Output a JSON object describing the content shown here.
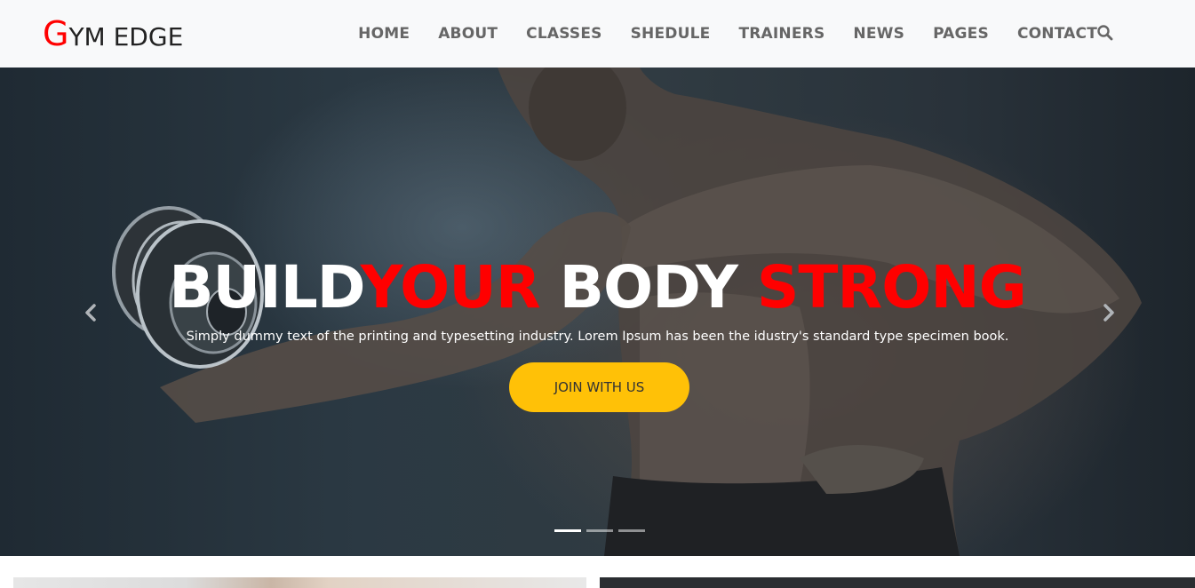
{
  "brand": {
    "logo_first": "G",
    "logo_rest": "YM EDGE",
    "accent_color": "#ff0000"
  },
  "nav": {
    "items": [
      {
        "label": "HOME"
      },
      {
        "label": "ABOUT"
      },
      {
        "label": "CLASSES"
      },
      {
        "label": "SHEDULE"
      },
      {
        "label": "TRAINERS"
      },
      {
        "label": "NEWS"
      },
      {
        "label": "PAGES"
      },
      {
        "label": "CONTACT"
      }
    ],
    "search_icon": "search-icon"
  },
  "hero": {
    "title_part1": "BUILD",
    "title_part2": "YOUR",
    "title_part3": " BODY ",
    "title_part4": "STRONG",
    "subtitle": "Simply dummy text of the printing and typesetting industry. Lorem Ipsum has been the idustry's standard type specimen book.",
    "cta_label": "JOIN WITH US",
    "cta_color": "#ffc107",
    "prev_icon": "chevron-left-icon",
    "next_icon": "chevron-right-icon",
    "slides_total": 3,
    "active_slide": 1
  }
}
